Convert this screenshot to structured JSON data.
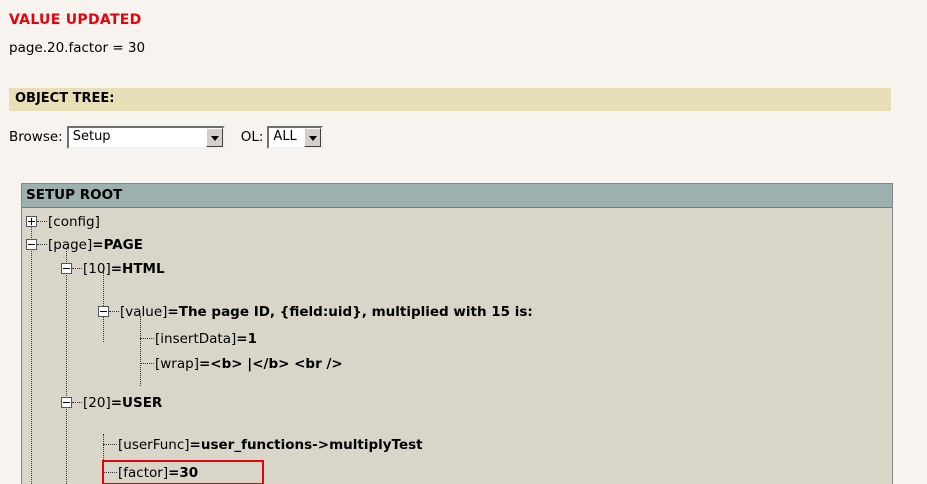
{
  "message": {
    "title": "VALUE UPDATED",
    "text": "page.20.factor = 30"
  },
  "object_tree_header": "OBJECT TREE:",
  "browse": {
    "label": "Browse:",
    "selected": "Setup",
    "ol_label": "OL:",
    "ol_selected": "ALL"
  },
  "tree": {
    "root_label": "SETUP ROOT",
    "nodes": [
      {
        "key": "[config]",
        "value": ""
      },
      {
        "key": "[page]",
        "value": "=PAGE"
      },
      {
        "key": "[10]",
        "value": "=HTML"
      },
      {
        "key": "[value]",
        "value": "=The page ID, {field:uid}, multiplied with 15 is:"
      },
      {
        "key": "[insertData]",
        "value": "=1"
      },
      {
        "key": "[wrap]",
        "value": "=<b> |</b> <br />"
      },
      {
        "key": "[20]",
        "value": "=USER"
      },
      {
        "key": "[userFunc]",
        "value": "=user_functions->multiplyTest"
      },
      {
        "key": "[factor]",
        "value": "=30"
      }
    ]
  },
  "colors": {
    "accent_red": "#e8000b",
    "section_header_bg": "#e9dfb6",
    "tree_header_bg": "#9db0b0",
    "tree_body_bg": "#d9d5c9"
  }
}
